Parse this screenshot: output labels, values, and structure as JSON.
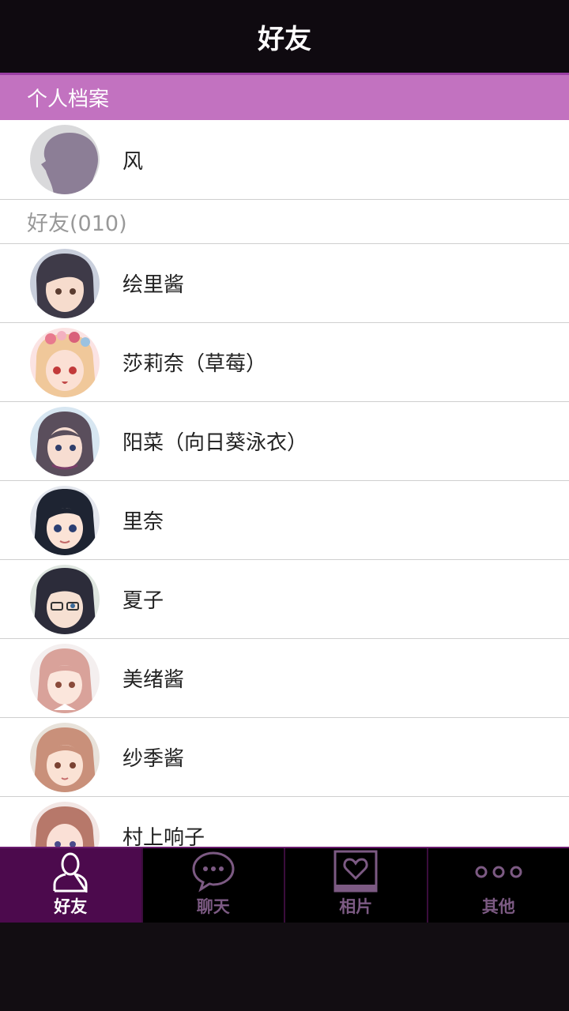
{
  "header": {
    "title": "好友"
  },
  "section": {
    "profile_label": "个人档案"
  },
  "profile": {
    "name": "风"
  },
  "friends": {
    "group_label": "好友(010)",
    "items": [
      {
        "name": "绘里酱"
      },
      {
        "name": "莎莉奈（草莓）"
      },
      {
        "name": "阳菜（向日葵泳衣）"
      },
      {
        "name": "里奈"
      },
      {
        "name": "夏子"
      },
      {
        "name": "美绪酱"
      },
      {
        "name": "纱季酱"
      },
      {
        "name": "村上响子"
      }
    ]
  },
  "tabs": [
    {
      "label": "好友",
      "icon": "person-icon",
      "active": true
    },
    {
      "label": "聊天",
      "icon": "chat-bubble-icon",
      "active": false
    },
    {
      "label": "相片",
      "icon": "heart-photo-icon",
      "active": false
    },
    {
      "label": "其他",
      "icon": "more-dots-icon",
      "active": false
    }
  ],
  "colors": {
    "accent": "#c272c0",
    "tab_active": "#4c0a4d",
    "header_bg": "#0f0a10"
  }
}
